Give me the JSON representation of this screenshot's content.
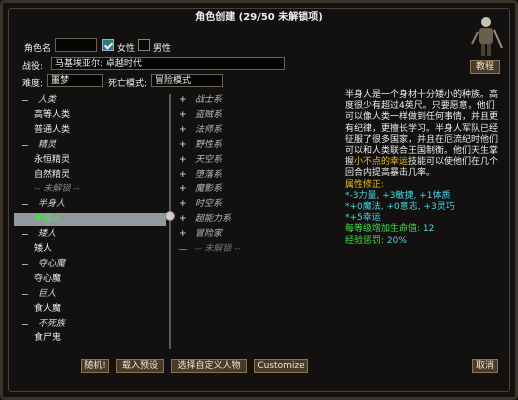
{
  "window": {
    "title": "角色创建 (29/50 未解锁项)"
  },
  "form": {
    "name_label": "角色名",
    "name_value": "",
    "female_label": "女性",
    "female_checked": true,
    "male_label": "男性",
    "male_checked": false,
    "campaign_label": "战役:",
    "campaign_value": "马基埃亚尔: 卓越时代",
    "difficulty_label": "难度:",
    "difficulty_value": "噩梦",
    "death_mode_label": "死亡模式:",
    "death_mode_value": "冒险模式"
  },
  "tutorial_label": "教程",
  "race_tree": [
    {
      "kind": "cat",
      "label": "人类"
    },
    {
      "kind": "item",
      "label": "高等人类"
    },
    {
      "kind": "item",
      "label": "普通人类"
    },
    {
      "kind": "cat",
      "label": "精灵"
    },
    {
      "kind": "item",
      "label": "永恒精灵"
    },
    {
      "kind": "item",
      "label": "自然精灵"
    },
    {
      "kind": "div",
      "label": "-- 未解锁 --"
    },
    {
      "kind": "cat",
      "label": "半身人"
    },
    {
      "kind": "item",
      "label": "半身人",
      "selected": true
    },
    {
      "kind": "cat",
      "label": "矮人"
    },
    {
      "kind": "item",
      "label": "矮人"
    },
    {
      "kind": "cat",
      "label": "夺心魔"
    },
    {
      "kind": "item",
      "label": "夺心魔"
    },
    {
      "kind": "cat",
      "label": "巨人"
    },
    {
      "kind": "item",
      "label": "食人魔"
    },
    {
      "kind": "cat",
      "label": "不死族"
    },
    {
      "kind": "item",
      "label": "食尸鬼"
    }
  ],
  "class_tree": [
    {
      "kind": "cat",
      "label": "战士系"
    },
    {
      "kind": "cat",
      "label": "盗贼系"
    },
    {
      "kind": "cat",
      "label": "法师系"
    },
    {
      "kind": "cat",
      "label": "野性系"
    },
    {
      "kind": "cat",
      "label": "天空系"
    },
    {
      "kind": "cat",
      "label": "堕落系"
    },
    {
      "kind": "cat",
      "label": "魔影系"
    },
    {
      "kind": "cat",
      "label": "时空系"
    },
    {
      "kind": "cat",
      "label": "超能力系"
    },
    {
      "kind": "cat",
      "label": "冒险家"
    },
    {
      "kind": "div",
      "label": "-- 未解锁 --"
    }
  ],
  "description": {
    "intro": "半身人是一个身材十分矮小的种族。高度很少有超过4英尺。只要愿意，他们可以像人类一样做到任何事情，并且更有纪律，更擅长学习。半身人军队已经征服了很多国家，并且在厄流纪时他们可以和人类联合王国制衡。他们天生掌握",
    "luck_term": "小不点的幸运",
    "intro_tail": "技能可以使他们在几个回合内提高暴击几率。",
    "attr_header": "属性修正:",
    "stats_line1": "*-3力量, +3敏捷, +1体质",
    "stats_line2": "*+0魔法, +0意志, +3灵巧",
    "stats_line3": "*+5幸运",
    "life_label": "每等级增加生命值:",
    "life_value": "12",
    "exp_label": "经验惩罚:",
    "exp_value": "20%"
  },
  "buttons": {
    "random": "随机!",
    "load_preset": "载入预设",
    "custom_char": "选择自定义人物",
    "customize": "Customize",
    "cancel": "取消"
  },
  "colors": {
    "selected_text": "#3fef3f",
    "highlight_gold": "#e6c11b",
    "stat_cyan": "#49d6e6",
    "stat_green": "#3fe04a"
  }
}
